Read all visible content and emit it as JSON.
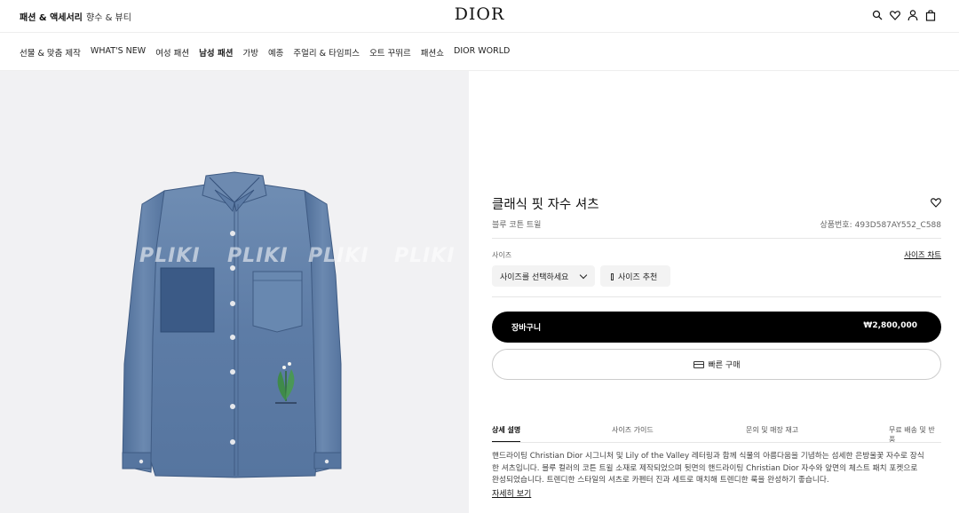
{
  "header": {
    "categories": [
      "패션 & 액세서리",
      "향수 & 뷰티"
    ],
    "brand": "DIOR",
    "icons": [
      "search-icon",
      "heart-icon",
      "user-icon",
      "bag-icon"
    ]
  },
  "nav": {
    "items": [
      "선물 & 맞춤 제작",
      "WHAT'S NEW",
      "여성 패션",
      "남성 패션",
      "가방",
      "예종",
      "주얼리 & 타임피스",
      "오트 꾸뛰르",
      "패션쇼",
      "DIOR WORLD"
    ],
    "active": "남성 패션"
  },
  "gallery": {
    "watermark": [
      "PLIKI",
      "PLIKI",
      "PLIKI",
      "PLIKI"
    ]
  },
  "product": {
    "title": "클래식 핏 자수 셔츠",
    "subtitle": "블루 코튼 트윌",
    "sku_label": "상품번호:",
    "sku": "493D587AY552_C588",
    "size_label": "사이즈",
    "size_chart": "사이즈 차트",
    "size_select": "사이즈를 선택하세요",
    "size_reco": "사이즈 추천",
    "cart_label": "장바구니",
    "price": "₩2,800,000",
    "quick_buy": "빠른 구매"
  },
  "tabs": [
    "상세 설명",
    "사이즈 가이드",
    "문의 및 매장 재고",
    "무료 배송 및 반품"
  ],
  "description": {
    "lines": [
      "핸드라이팅 Christian Dior 시그니처 및 Lily of the Valley 레터링과 함께 식물의 아름다움을 기념하는 섬세한 은방울꽃 자수로 장식",
      "한 셔츠입니다. 블루 컬러의 코튼 트윌 소재로 제작되었으며 뒷면의 핸드라이팅 Christian Dior 자수와 앞면의 체스트 패치 포켓으로",
      "완성되었습니다. 트렌디한 스타일의 셔츠로 카펜터 진과 세트로 매치해 트렌디한 룩을 완성하기 좋습니다."
    ],
    "more": "자세히 보기"
  },
  "colors": {
    "denim": "#5f7ea6",
    "denim_dark": "#3e5d88",
    "panel_bg": "#f1f1f3",
    "cart_bg": "#000000"
  }
}
